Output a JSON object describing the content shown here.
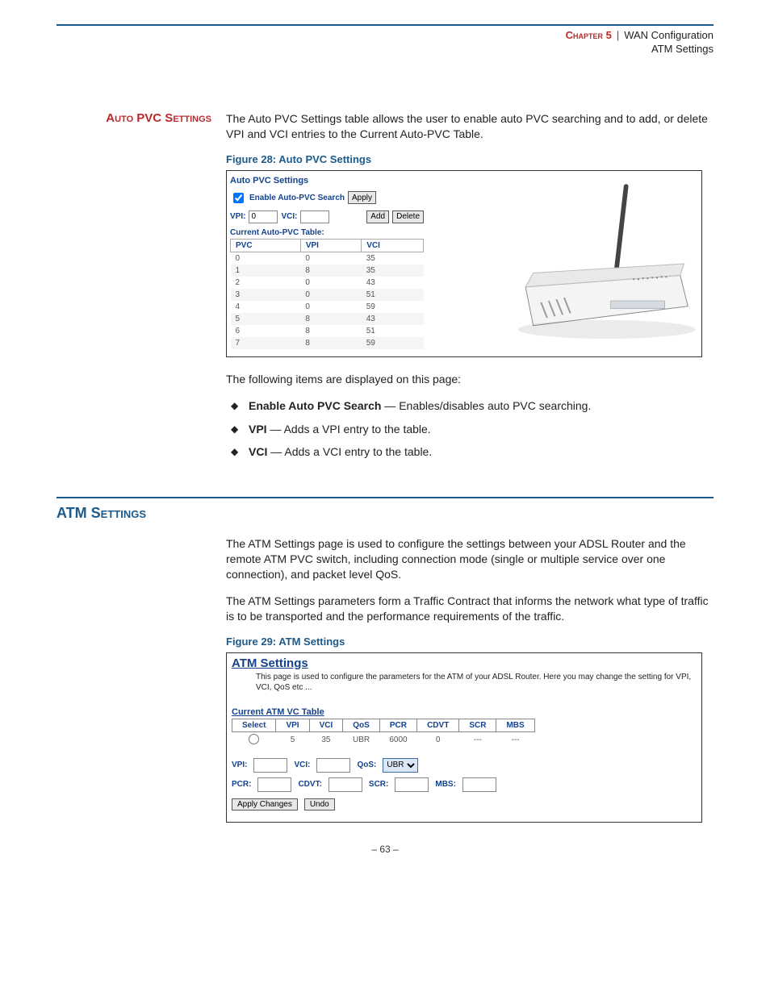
{
  "header": {
    "chapter": "Chapter 5",
    "sep": "|",
    "title": "WAN Configuration",
    "subtitle": "ATM Settings"
  },
  "auto_pvc": {
    "side_heading": "Auto PVC Settings",
    "intro": "The Auto PVC Settings table allows the user to enable auto PVC searching and to add, or delete VPI and VCI entries to the Current Auto-PVC Table.",
    "fig_caption": "Figure 28:  Auto PVC Settings",
    "panel_title": "Auto PVC Settings",
    "enable_label": "Enable Auto-PVC Search",
    "apply_btn": "Apply",
    "vpi_label": "VPI:",
    "vpi_value": "0",
    "vci_label": "VCI:",
    "vci_value": "",
    "add_btn": "Add",
    "delete_btn": "Delete",
    "table_label": "Current Auto-PVC Table:",
    "cols": {
      "pvc": "PVC",
      "vpi": "VPI",
      "vci": "VCI"
    },
    "rows": [
      {
        "pvc": "0",
        "vpi": "0",
        "vci": "35"
      },
      {
        "pvc": "1",
        "vpi": "8",
        "vci": "35"
      },
      {
        "pvc": "2",
        "vpi": "0",
        "vci": "43"
      },
      {
        "pvc": "3",
        "vpi": "0",
        "vci": "51"
      },
      {
        "pvc": "4",
        "vpi": "0",
        "vci": "59"
      },
      {
        "pvc": "5",
        "vpi": "8",
        "vci": "43"
      },
      {
        "pvc": "6",
        "vpi": "8",
        "vci": "51"
      },
      {
        "pvc": "7",
        "vpi": "8",
        "vci": "59"
      }
    ],
    "displayed_intro": "The following items are displayed on this page:",
    "items": [
      {
        "term": "Enable Auto PVC Search",
        "desc": " — Enables/disables auto PVC searching."
      },
      {
        "term": "VPI",
        "desc": " — Adds a VPI entry to the table."
      },
      {
        "term": "VCI",
        "desc": " — Adds a VCI entry to the table."
      }
    ]
  },
  "atm": {
    "heading": "ATM Settings",
    "p1": "The ATM Settings page is used to configure the settings between your ADSL Router and the remote ATM PVC switch, including connection mode (single or multiple service over one connection), and packet level QoS.",
    "p2": "The ATM Settings parameters form a Traffic Contract that informs the network what type of traffic is to be transported and the performance requirements of the traffic.",
    "fig_caption": "Figure 29:  ATM Settings",
    "panel_title": "ATM Settings",
    "panel_desc": "This page is used to configure the parameters for the ATM of your ADSL Router. Here you may change the setting for VPI, VCI, QoS etc ...",
    "table_label": "Current ATM VC Table",
    "cols": {
      "select": "Select",
      "vpi": "VPI",
      "vci": "VCI",
      "qos": "QoS",
      "pcr": "PCR",
      "cdvt": "CDVT",
      "scr": "SCR",
      "mbs": "MBS"
    },
    "row": {
      "vpi": "5",
      "vci": "35",
      "qos": "UBR",
      "pcr": "6000",
      "cdvt": "0",
      "scr": "---",
      "mbs": "---"
    },
    "form": {
      "vpi": "VPI:",
      "vci": "VCI:",
      "qos": "QoS:",
      "qos_value": "UBR",
      "pcr": "PCR:",
      "cdvt": "CDVT:",
      "scr": "SCR:",
      "mbs": "MBS:",
      "apply": "Apply Changes",
      "undo": "Undo"
    }
  },
  "page_number": "–  63  –"
}
